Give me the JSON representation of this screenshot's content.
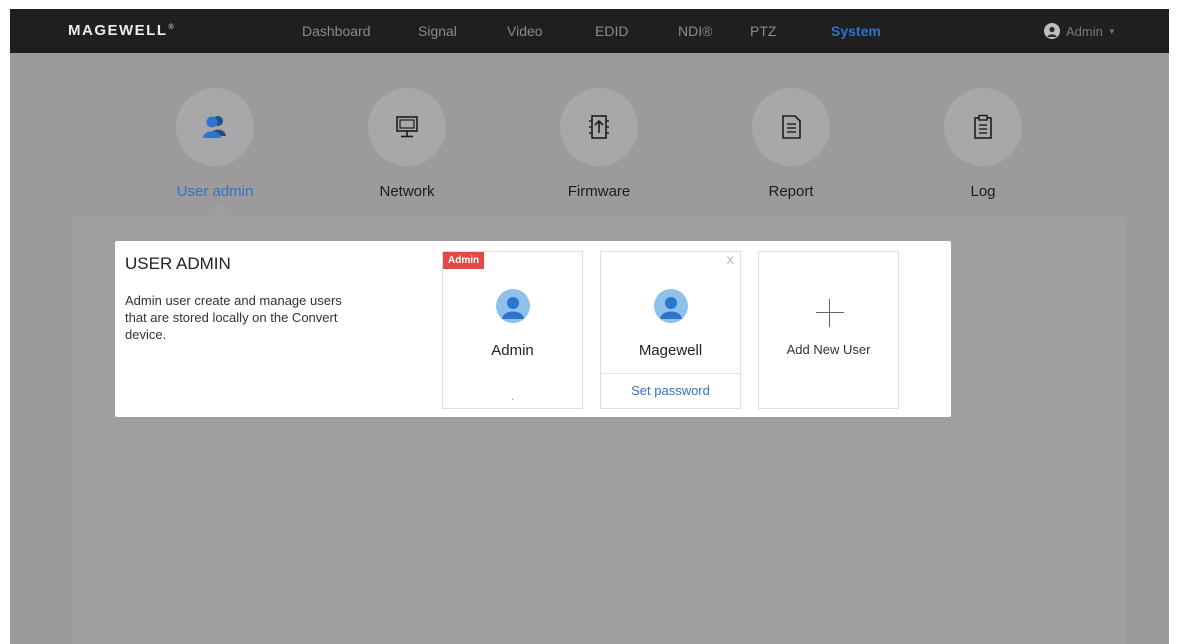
{
  "brand": {
    "logo": "MAGEWELL",
    "trademark": "®"
  },
  "nav": {
    "items": [
      {
        "label": "Dashboard"
      },
      {
        "label": "Signal"
      },
      {
        "label": "Video"
      },
      {
        "label": "EDID"
      },
      {
        "label": "NDI®"
      },
      {
        "label": "PTZ"
      },
      {
        "label": "System",
        "active": true
      }
    ],
    "user": {
      "label": "Admin",
      "icon": "user-icon",
      "caret_icon": "caret-down-icon"
    }
  },
  "categories": [
    {
      "label": "User admin",
      "icon": "users-icon",
      "active": true
    },
    {
      "label": "Network",
      "icon": "monitor-icon"
    },
    {
      "label": "Firmware",
      "icon": "firmware-upload-icon"
    },
    {
      "label": "Report",
      "icon": "document-icon"
    },
    {
      "label": "Log",
      "icon": "clipboard-icon"
    }
  ],
  "user_admin": {
    "title": "USER ADMIN",
    "description": "Admin user create and manage users that are stored locally on the Convert device.",
    "users": [
      {
        "name": "Admin",
        "badge": "Admin",
        "footer": "."
      },
      {
        "name": "Magewell",
        "close": "X",
        "action": "Set password"
      }
    ],
    "add_user": {
      "label": "Add New User",
      "icon": "plus-icon"
    }
  },
  "colors": {
    "nav_bg": "#1f1f1f",
    "accent": "#2e74cc",
    "overlay": "#9b9b9b",
    "badge": "#e84747",
    "avatar": "#8ec0ec"
  }
}
